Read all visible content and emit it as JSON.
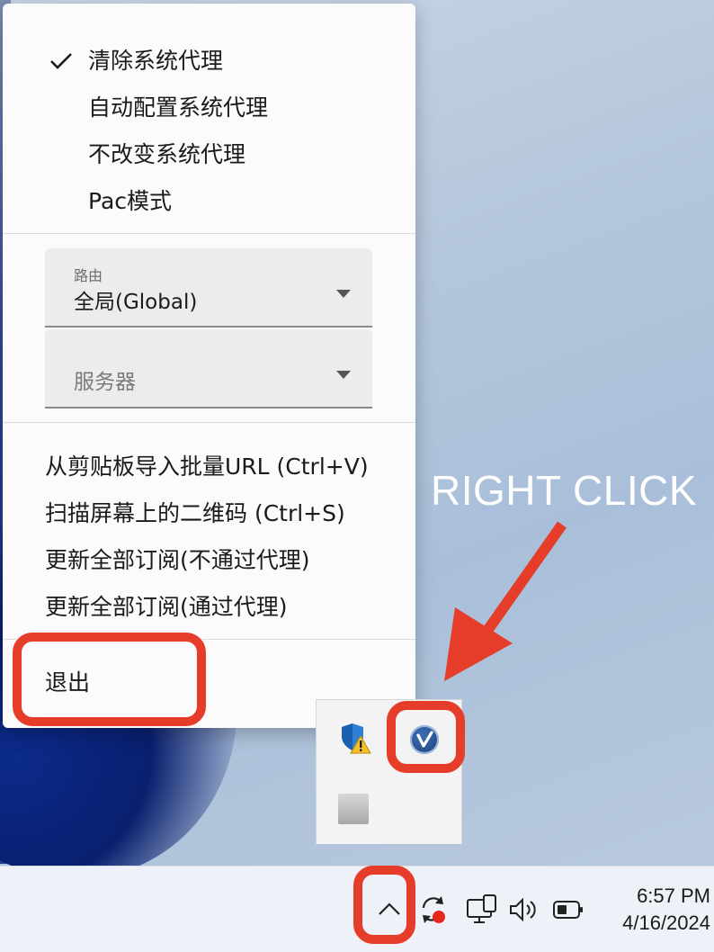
{
  "menu": {
    "proxy_options": [
      {
        "label": "清除系统代理",
        "checked": true
      },
      {
        "label": "自动配置系统代理",
        "checked": false
      },
      {
        "label": "不改变系统代理",
        "checked": false
      },
      {
        "label": "Pac模式",
        "checked": false
      }
    ],
    "routing": {
      "label": "路由",
      "value": "全局(Global)"
    },
    "server": {
      "placeholder": "服务器"
    },
    "actions": [
      {
        "label": "从剪贴板导入批量URL (Ctrl+V)"
      },
      {
        "label": "扫描屏幕上的二维码 (Ctrl+S)"
      },
      {
        "label": "更新全部订阅(不通过代理)"
      },
      {
        "label": "更新全部订阅(通过代理)"
      }
    ],
    "exit_label": "退出"
  },
  "annotation": {
    "text": "RIGHT CLICK",
    "color": "#e63c2a"
  },
  "tray_flyout": {
    "icons": [
      "defender-warning-icon",
      "v2rayn-icon",
      "generic-app-icon"
    ]
  },
  "taskbar": {
    "tray_icons": [
      "chevron-up-icon",
      "sync-icon",
      "network-icon",
      "volume-icon",
      "battery-icon"
    ],
    "time": "6:57 PM",
    "date": "4/16/2024"
  }
}
